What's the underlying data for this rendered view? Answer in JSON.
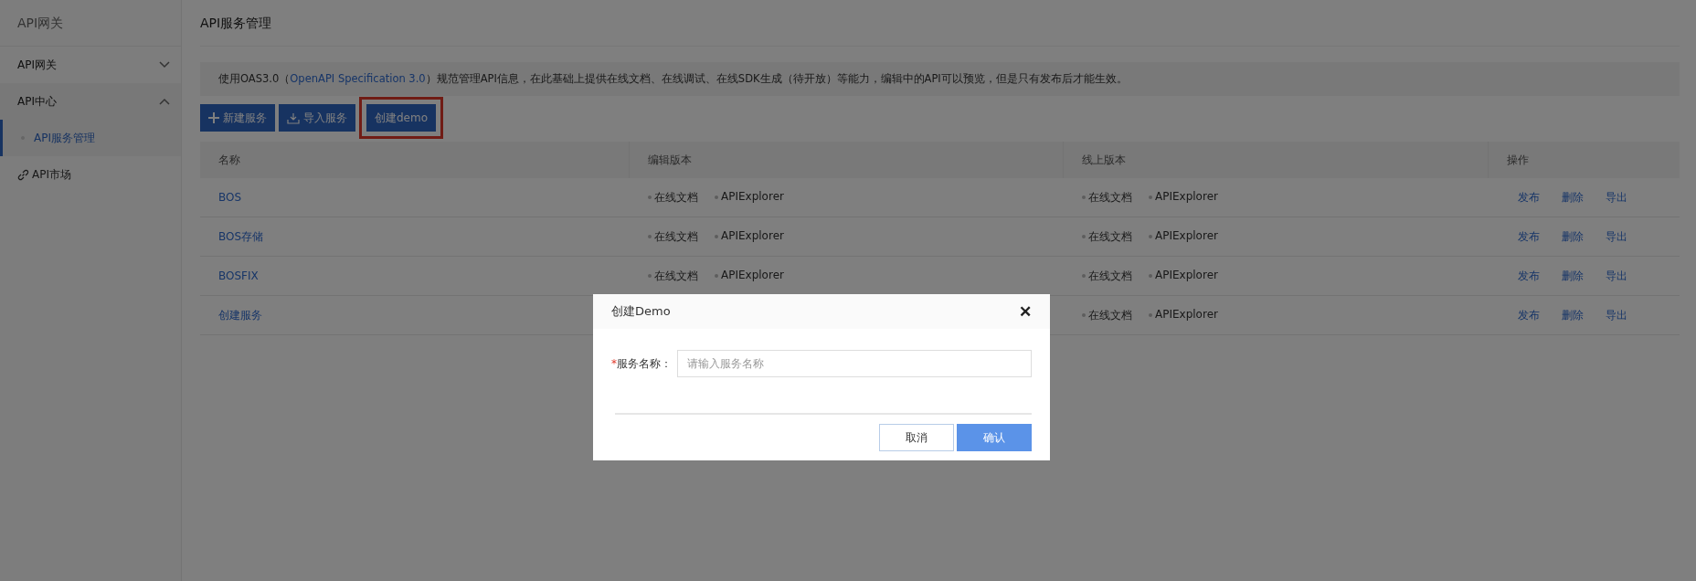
{
  "sidebar": {
    "title": "API网关",
    "items": [
      {
        "label": "API网关",
        "kind": "group",
        "expanded": false
      },
      {
        "label": "API中心",
        "kind": "group",
        "expanded": true,
        "children": [
          {
            "label": "API服务管理",
            "selected": true
          }
        ]
      },
      {
        "label": "API市场",
        "kind": "link"
      }
    ]
  },
  "page_title": "API服务管理",
  "notice": {
    "before": "使用OAS3.0（",
    "link": "OpenAPI Specification 3.0",
    "after": "）规范管理API信息，在此基础上提供在线文档、在线调试、在线SDK生成（待开放）等能力，编辑中的API可以预览，但是只有发布后才能生效。"
  },
  "toolbar": [
    {
      "label": "新建服务",
      "kind": "add"
    },
    {
      "label": "导入服务",
      "kind": "import"
    },
    {
      "label": "创建demo",
      "kind": "plain",
      "highlighted": true
    }
  ],
  "table": {
    "columns": [
      "名称",
      "编辑版本",
      "线上版本",
      "操作"
    ],
    "rows": [
      {
        "name": "BOS",
        "edit_version": [
          "在线文档",
          "APIExplorer"
        ],
        "online_version": [
          "在线文档",
          "APIExplorer"
        ],
        "actions": [
          "发布",
          "删除",
          "导出"
        ]
      },
      {
        "name": "BOS存储",
        "edit_version": [
          "在线文档",
          "APIExplorer"
        ],
        "online_version": [
          "在线文档",
          "APIExplorer"
        ],
        "actions": [
          "发布",
          "删除",
          "导出"
        ]
      },
      {
        "name": "BOSFIX",
        "edit_version": [
          "在线文档",
          "APIExplorer"
        ],
        "online_version": [
          "在线文档",
          "APIExplorer"
        ],
        "actions": [
          "发布",
          "删除",
          "导出"
        ]
      },
      {
        "name": "创建服务",
        "online_version": [
          "在线文档",
          "APIExplorer"
        ],
        "actions": [
          "发布",
          "删除",
          "导出"
        ]
      }
    ]
  },
  "dialog": {
    "title": "创建Demo",
    "close": "✕",
    "field": {
      "label": "服务名称：",
      "required_mark": "*",
      "placeholder": "请输入服务名称"
    },
    "buttons": [
      {
        "label": "取消",
        "primary": false
      },
      {
        "label": "确认",
        "primary": true
      }
    ]
  }
}
